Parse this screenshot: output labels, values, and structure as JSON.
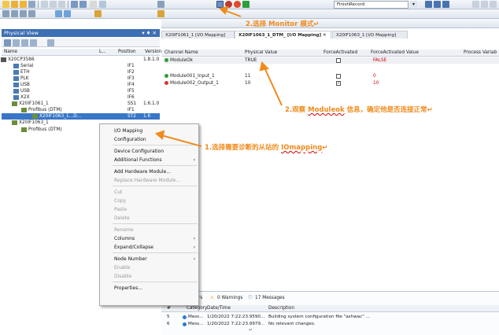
{
  "toolbar": {
    "record_select": "FinishRecord"
  },
  "physical_view": {
    "title": "Physical View",
    "pin": "▾ ♦ ✕",
    "columns": [
      "Name",
      "L...",
      "Position",
      "Version"
    ],
    "rows": [
      {
        "name": "X20CP3586",
        "pos": "",
        "ver": "1.8.1.0"
      },
      {
        "name": "Serial",
        "pos": "IF1",
        "ver": ""
      },
      {
        "name": "ETH",
        "pos": "IF2",
        "ver": ""
      },
      {
        "name": "PLK",
        "pos": "IF3",
        "ver": ""
      },
      {
        "name": "USB",
        "pos": "IF4",
        "ver": ""
      },
      {
        "name": "USB",
        "pos": "IF5",
        "ver": ""
      },
      {
        "name": "X2X",
        "pos": "IF6",
        "ver": ""
      },
      {
        "name": "X20IF1061_1",
        "pos": "SS1",
        "ver": "1.6.1.0"
      },
      {
        "name": "Profibus (DTM)",
        "pos": "IF1",
        "ver": ""
      },
      {
        "name": "X20IF1063_1...D...",
        "pos": "ST2",
        "ver": "1.6"
      },
      {
        "name": "X20IF1063_1",
        "pos": "",
        "ver": ""
      },
      {
        "name": "Profibus (DTM)",
        "pos": "",
        "ver": ""
      }
    ]
  },
  "tabs": [
    {
      "label": "X20IF1061_1 [I/O Mapping]"
    },
    {
      "label": "X20IF1063_1_DTM_ [I/O Mapping]",
      "close": "✕"
    },
    {
      "label": "X20IF1063_1 [I/O Mapping]"
    }
  ],
  "io_grid": {
    "columns": [
      "Channel Name",
      "Physical Value",
      "ForceActivated",
      "ForceActivated Value",
      "Process Variab"
    ],
    "rows": [
      {
        "name": "ModuleOk",
        "value": "TRUE",
        "checked": false,
        "fvalue": "FALSE",
        "fvalue_color": "#d00000"
      },
      {
        "name": "Module001_Input_1",
        "value": "11",
        "checked": false,
        "fvalue": "0",
        "fvalue_color": "#d00000"
      },
      {
        "name": "Module002_Output_1",
        "value": "10",
        "checked": true,
        "fvalue": "10",
        "fvalue_color": "#d00000"
      }
    ]
  },
  "context_menu": {
    "items": [
      {
        "label": "I/O Mapping",
        "disabled": false,
        "sub": false
      },
      {
        "label": "Configuration",
        "disabled": false,
        "sub": false
      },
      {
        "sep": true
      },
      {
        "label": "Device Configuration",
        "disabled": false,
        "sub": false
      },
      {
        "label": "Additional Functions",
        "disabled": false,
        "sub": true
      },
      {
        "sep": true
      },
      {
        "label": "Add Hardware Module...",
        "disabled": false,
        "sub": false
      },
      {
        "label": "Replace Hardware Module...",
        "disabled": true,
        "sub": false
      },
      {
        "sep": true
      },
      {
        "label": "Cut",
        "disabled": true,
        "sub": false
      },
      {
        "label": "Copy",
        "disabled": true,
        "sub": false
      },
      {
        "label": "Paste",
        "disabled": true,
        "sub": false
      },
      {
        "label": "Delete",
        "disabled": true,
        "sub": false
      },
      {
        "sep": true
      },
      {
        "label": "Rename",
        "disabled": true,
        "sub": false
      },
      {
        "label": "Columns",
        "disabled": false,
        "sub": true
      },
      {
        "label": "Expand/Collapse",
        "disabled": false,
        "sub": true
      },
      {
        "sep": true
      },
      {
        "label": "Node Number",
        "disabled": false,
        "sub": true
      },
      {
        "label": "Enable",
        "disabled": true,
        "sub": false
      },
      {
        "label": "Disable",
        "disabled": true,
        "sub": false
      },
      {
        "sep": true
      },
      {
        "label": "Properties...",
        "disabled": false,
        "sub": false
      }
    ]
  },
  "output": {
    "errors": "rs",
    "warnings": "0 Warnings",
    "messages": "17 Messages",
    "columns": [
      "#",
      "Category",
      "Date/Time",
      "Description"
    ],
    "rows": [
      {
        "n": "5",
        "cat": "Mess...",
        "time": "1/20/2022 7:22:23.9590...",
        "desc": "Building system configuration file \"ashwac\" ..."
      },
      {
        "n": "6",
        "cat": "Mess...",
        "time": "1/20/2022 7:22:23.9979...",
        "desc": "No relevant changes."
      }
    ]
  },
  "annotations": {
    "a1_pre": "1.选择需要诊断的从站的 ",
    "a1_u": "IOmapping",
    "a1_post": "↵",
    "a2": "2.选择 Monitor 模式↵",
    "a3_pre": "2.观察 ",
    "a3_u": "Moduleok",
    "a3_post": " 信息，确定他是否连接正常↵",
    "bottom_mark": "↵"
  },
  "colors": {
    "accent": "#f08a1c",
    "title_bar": "#3d6fb4",
    "selection": "#3876c8"
  }
}
